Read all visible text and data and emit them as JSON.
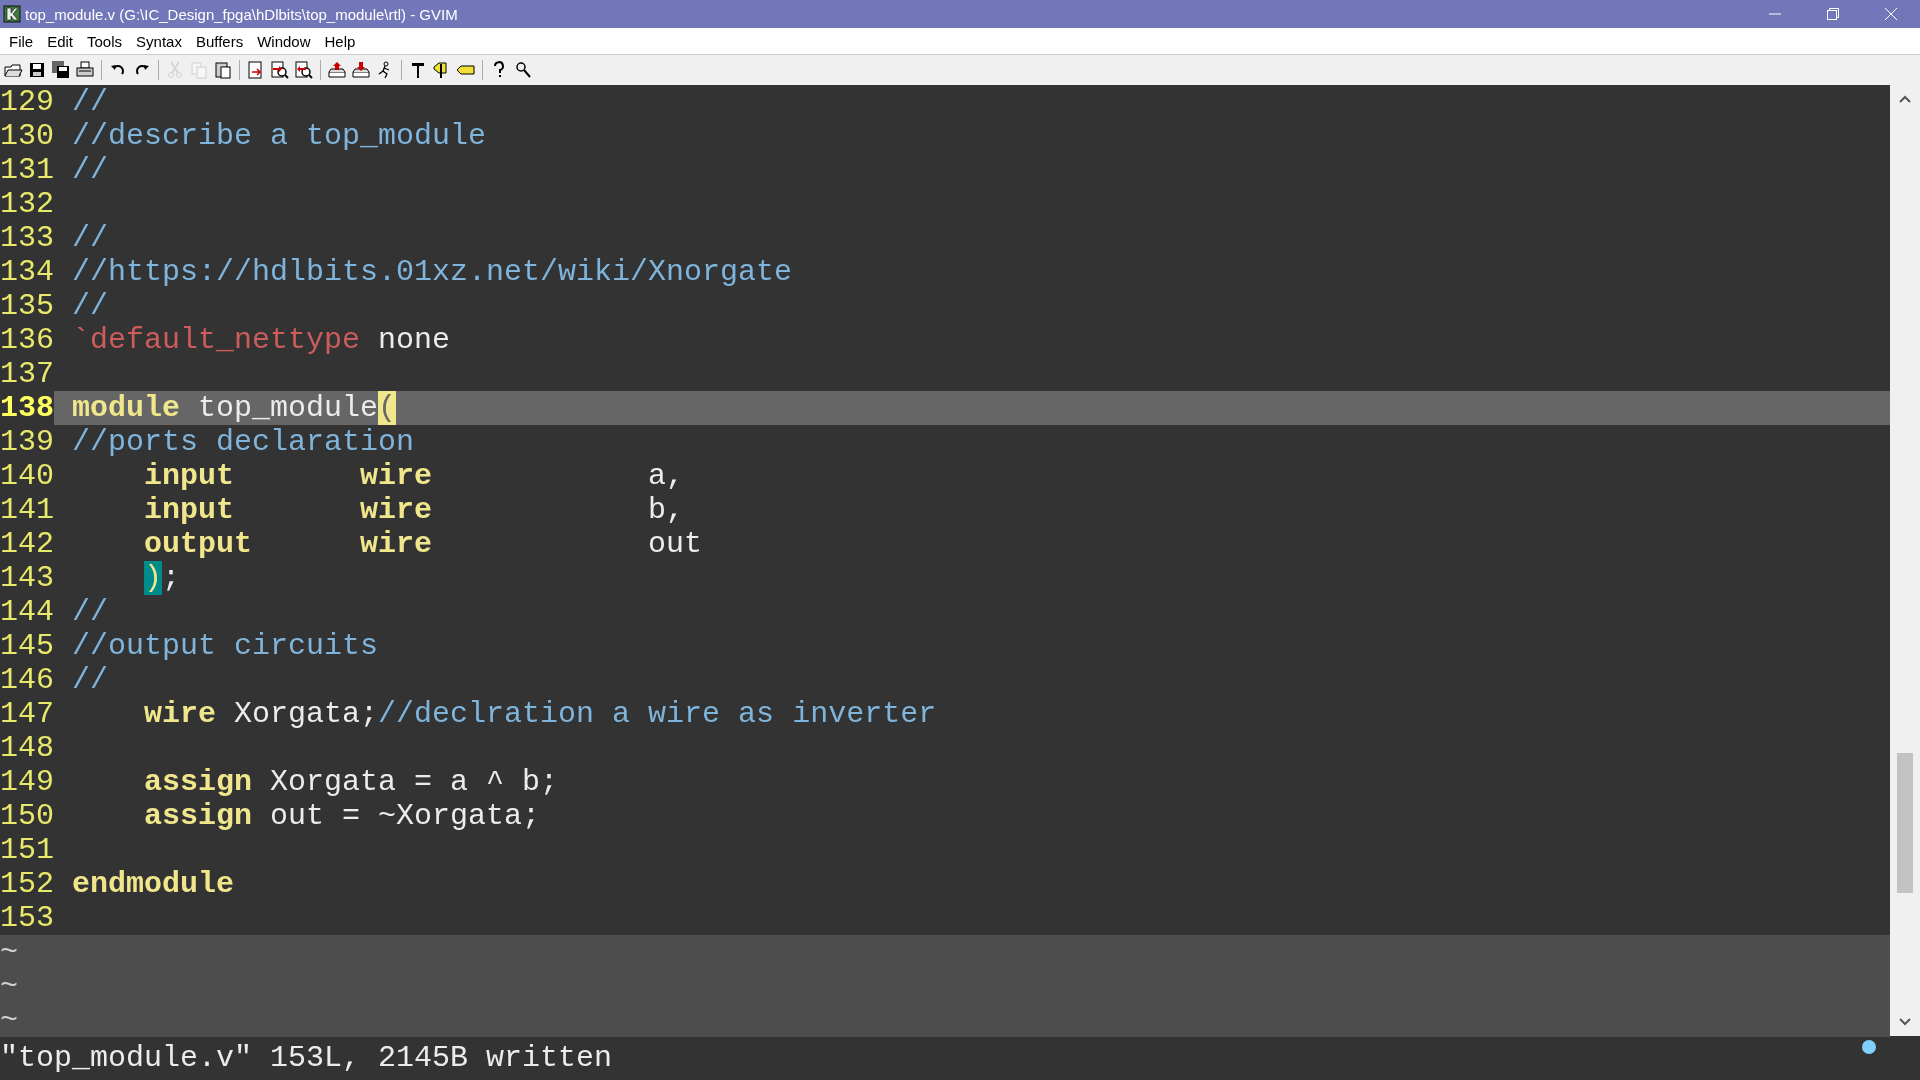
{
  "window": {
    "title": "top_module.v (G:\\IC_Design_fpga\\hDlbits\\top_module\\rtl) - GVIM"
  },
  "menu": [
    "File",
    "Edit",
    "Tools",
    "Syntax",
    "Buffers",
    "Window",
    "Help"
  ],
  "toolbar": [
    [
      {
        "kind": "open",
        "disabled": false
      },
      {
        "kind": "save",
        "disabled": false
      },
      {
        "kind": "save-all",
        "disabled": false
      },
      {
        "kind": "print",
        "disabled": false
      }
    ],
    [
      {
        "kind": "undo",
        "disabled": false
      },
      {
        "kind": "redo",
        "disabled": false
      }
    ],
    [
      {
        "kind": "cut",
        "disabled": true
      },
      {
        "kind": "copy",
        "disabled": true
      },
      {
        "kind": "paste",
        "disabled": false
      }
    ],
    [
      {
        "kind": "replace",
        "disabled": false
      },
      {
        "kind": "find-next",
        "disabled": false
      },
      {
        "kind": "find-prev",
        "disabled": false
      }
    ],
    [
      {
        "kind": "load-session",
        "disabled": false
      },
      {
        "kind": "save-session",
        "disabled": false
      },
      {
        "kind": "run-script",
        "disabled": false
      }
    ],
    [
      {
        "kind": "make",
        "disabled": false
      },
      {
        "kind": "tags",
        "disabled": false
      },
      {
        "kind": "jump-tag",
        "disabled": false
      }
    ],
    [
      {
        "kind": "help",
        "disabled": false
      },
      {
        "kind": "find-help",
        "disabled": false
      }
    ]
  ],
  "lines": [
    {
      "number": "129",
      "current": false,
      "segments": [
        {
          "kind": "comment",
          "text": "//"
        }
      ]
    },
    {
      "number": "130",
      "current": false,
      "segments": [
        {
          "kind": "comment",
          "text": "//describe a top_module"
        }
      ]
    },
    {
      "number": "131",
      "current": false,
      "segments": [
        {
          "kind": "comment",
          "text": "//"
        }
      ]
    },
    {
      "number": "132",
      "current": false
    },
    {
      "number": "133",
      "current": false,
      "segments": [
        {
          "kind": "comment",
          "text": "//"
        }
      ]
    },
    {
      "number": "134",
      "current": false,
      "segments": [
        {
          "kind": "comment",
          "text": "//https://hdlbits.01xz.net/wiki/Xnorgate"
        }
      ]
    },
    {
      "number": "135",
      "current": false,
      "segments": [
        {
          "kind": "comment",
          "text": "//"
        }
      ]
    },
    {
      "number": "136",
      "current": false,
      "segments": [
        {
          "kind": "preproc",
          "text": "`default_nettype"
        },
        {
          "kind": "normal",
          "text": " none"
        }
      ]
    },
    {
      "number": "137",
      "current": false
    },
    {
      "number": "138",
      "current": true,
      "segments": [
        {
          "kind": "keyword",
          "text": "module"
        },
        {
          "kind": "normal",
          "text": " top_module"
        },
        {
          "kind": "cursor",
          "text": "("
        }
      ]
    },
    {
      "number": "139",
      "current": false,
      "segments": [
        {
          "kind": "comment",
          "text": "//ports declaration"
        }
      ]
    },
    {
      "number": "140",
      "current": false,
      "segments": [
        {
          "kind": "keyword",
          "text": "    input       "
        },
        {
          "kind": "keyword",
          "text": "wire            "
        },
        {
          "kind": "normal",
          "text": "a,"
        }
      ]
    },
    {
      "number": "141",
      "current": false,
      "segments": [
        {
          "kind": "keyword",
          "text": "    input       "
        },
        {
          "kind": "keyword",
          "text": "wire            "
        },
        {
          "kind": "normal",
          "text": "b,"
        }
      ]
    },
    {
      "number": "142",
      "current": false,
      "segments": [
        {
          "kind": "keyword",
          "text": "    output      "
        },
        {
          "kind": "keyword",
          "text": "wire            "
        },
        {
          "kind": "normal",
          "text": "out"
        }
      ]
    },
    {
      "number": "143",
      "current": false,
      "segments": [
        {
          "kind": "match",
          "text": "    )"
        },
        {
          "kind": "normal",
          "text": ";"
        }
      ]
    },
    {
      "number": "144",
      "current": false,
      "segments": [
        {
          "kind": "comment",
          "text": "//"
        }
      ]
    },
    {
      "number": "145",
      "current": false,
      "segments": [
        {
          "kind": "comment",
          "text": "//output circuits"
        }
      ]
    },
    {
      "number": "146",
      "current": false,
      "segments": [
        {
          "kind": "comment",
          "text": "//"
        }
      ]
    },
    {
      "number": "147",
      "current": false,
      "segments": [
        {
          "kind": "keyword",
          "text": "    wire"
        },
        {
          "kind": "normal",
          "text": " Xorgata;"
        },
        {
          "kind": "comment",
          "text": "//declration a wire as inverter"
        }
      ]
    },
    {
      "number": "148",
      "current": false
    },
    {
      "number": "149",
      "current": false,
      "segments": [
        {
          "kind": "keyword",
          "text": "    assign"
        },
        {
          "kind": "normal",
          "text": " Xorgata = a ^ b;"
        }
      ]
    },
    {
      "number": "150",
      "current": false,
      "segments": [
        {
          "kind": "keyword",
          "text": "    assign"
        },
        {
          "kind": "normal",
          "text": " out = ~Xorgata;"
        }
      ]
    },
    {
      "number": "151",
      "current": false
    },
    {
      "number": "152",
      "current": false,
      "segments": [
        {
          "kind": "keyword",
          "text": "endmodule"
        }
      ]
    },
    {
      "number": "153",
      "current": false
    }
  ],
  "filler": [
    "~",
    "~",
    "~"
  ],
  "command_line": "\"top_module.v\" 153L, 2145B written"
}
